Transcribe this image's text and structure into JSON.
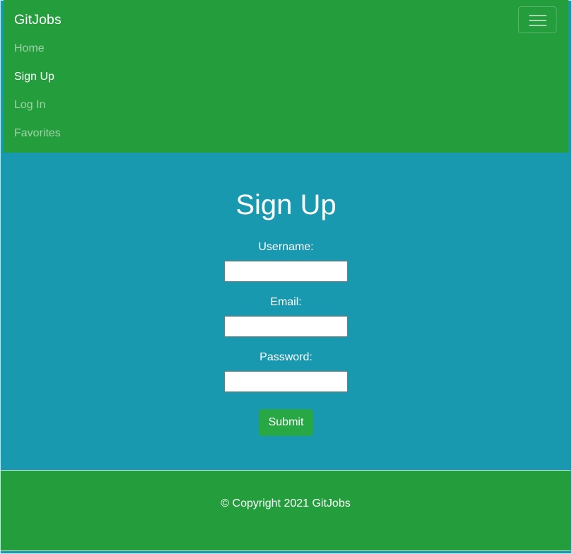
{
  "colors": {
    "navbar_bg": "#249d3c",
    "page_bg": "#1899b0",
    "footer_bg": "#249d3c",
    "button_bg": "#28a745"
  },
  "navbar": {
    "brand": "GitJobs",
    "toggler_icon": "hamburger-menu-icon",
    "items": [
      {
        "label": "Home",
        "active": false
      },
      {
        "label": "Sign Up",
        "active": true
      },
      {
        "label": "Log In",
        "active": false
      },
      {
        "label": "Favorites",
        "active": false
      }
    ]
  },
  "main": {
    "title": "Sign Up",
    "fields": {
      "username": {
        "label": "Username:",
        "value": ""
      },
      "email": {
        "label": "Email:",
        "value": ""
      },
      "password": {
        "label": "Password:",
        "value": ""
      }
    },
    "submit_label": "Submit"
  },
  "footer": {
    "text": "© Copyright 2021 GitJobs"
  }
}
